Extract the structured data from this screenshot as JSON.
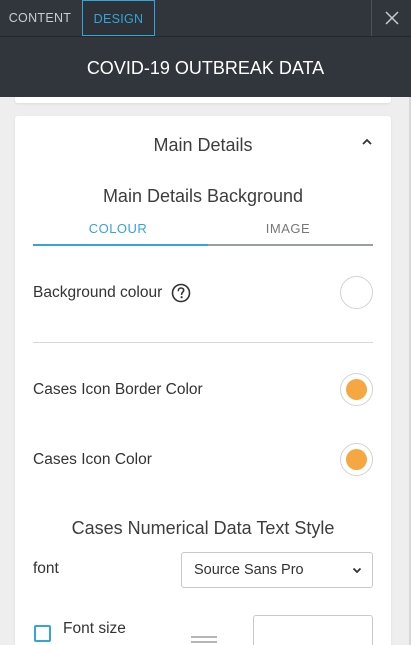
{
  "tabs": {
    "content_label": "CONTENT",
    "design_label": "DESIGN"
  },
  "header": {
    "title": "COVID-19 OUTBREAK DATA"
  },
  "main_details": {
    "section_title": "Main Details",
    "background_heading": "Main Details Background",
    "background_tabs": [
      "COLOUR",
      "IMAGE"
    ],
    "active_background_tab": "COLOUR",
    "background_colour_label": "Background colour",
    "background_colour_value": "#ffffff",
    "cases_icon_border_label": "Cases Icon Border Color",
    "cases_icon_border_value": "#f5a742",
    "cases_icon_color_label": "Cases Icon Color",
    "cases_icon_color_value": "#f5a742",
    "text_style_heading": "Cases Numerical Data Text Style",
    "font_label": "font",
    "font_value": "Source Sans Pro",
    "partial_label": "Font size"
  },
  "colors": {
    "accent": "#36a3d9",
    "header_bg": "#30363b"
  }
}
